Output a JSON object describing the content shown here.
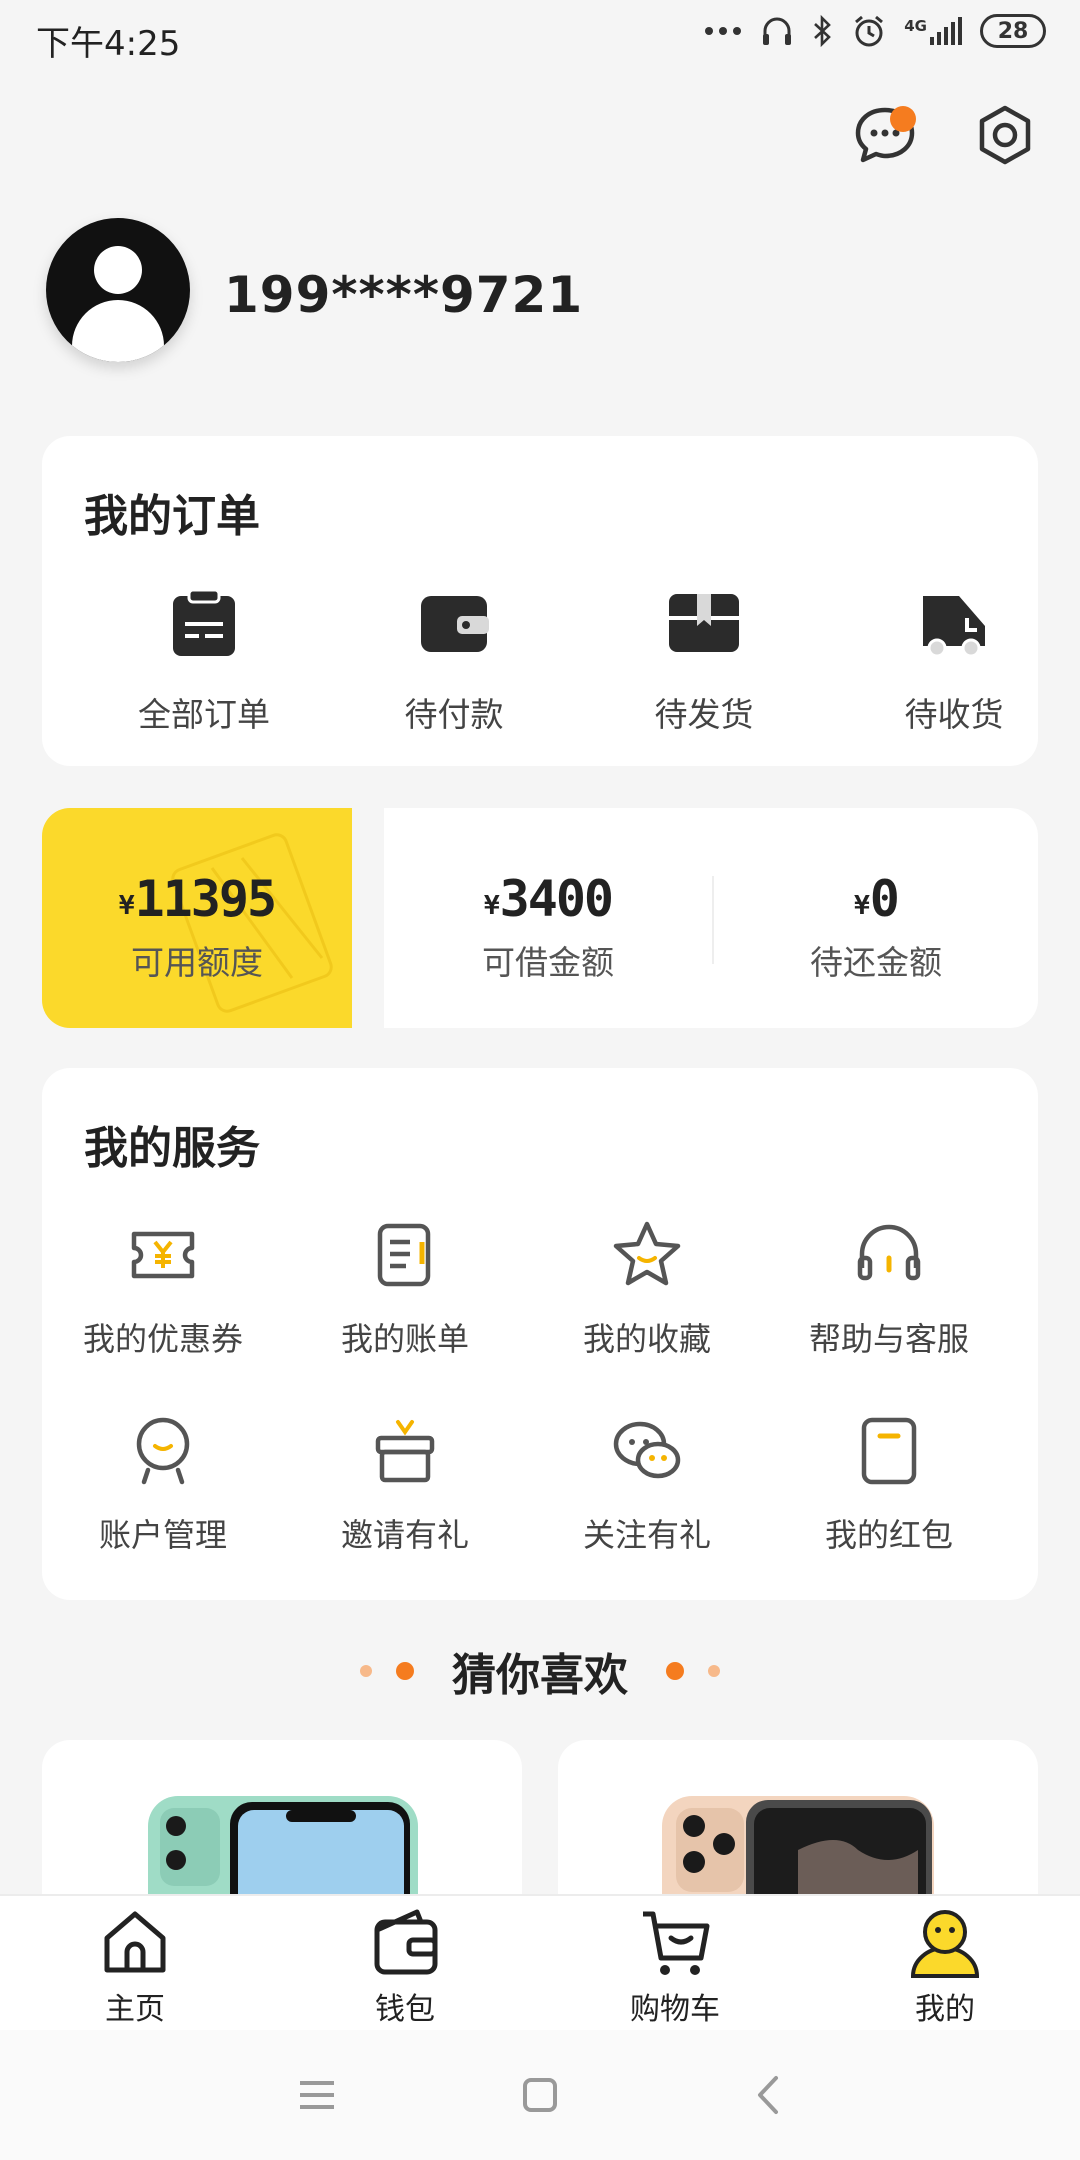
{
  "status_bar": {
    "time": "下午4:25",
    "network": "4G",
    "battery": "28"
  },
  "profile": {
    "phone": "199****9721"
  },
  "orders": {
    "title": "我的订单",
    "items": [
      {
        "label": "全部订单",
        "icon": "clipboard-icon"
      },
      {
        "label": "待付款",
        "icon": "wallet-icon"
      },
      {
        "label": "待发货",
        "icon": "box-icon"
      },
      {
        "label": "待收货",
        "icon": "truck-icon"
      }
    ]
  },
  "credit": {
    "available": {
      "currency": "¥",
      "amount": "11395",
      "label": "可用额度"
    },
    "borrowable": {
      "currency": "¥",
      "amount": "3400",
      "label": "可借金额"
    },
    "pending": {
      "currency": "¥",
      "amount": "0",
      "label": "待还金额"
    }
  },
  "services": {
    "title": "我的服务",
    "items": [
      {
        "label": "我的优惠券",
        "icon": "coupon-icon"
      },
      {
        "label": "我的账单",
        "icon": "bill-icon"
      },
      {
        "label": "我的收藏",
        "icon": "star-icon"
      },
      {
        "label": "帮助与客服",
        "icon": "headset-icon"
      },
      {
        "label": "账户管理",
        "icon": "account-icon"
      },
      {
        "label": "邀请有礼",
        "icon": "gift-icon"
      },
      {
        "label": "关注有礼",
        "icon": "wechat-icon"
      },
      {
        "label": "我的红包",
        "icon": "red-packet-icon"
      }
    ]
  },
  "recommend": {
    "title": "猜你喜欢"
  },
  "bottom_nav": {
    "items": [
      {
        "label": "主页",
        "icon": "home-icon"
      },
      {
        "label": "钱包",
        "icon": "wallet-icon"
      },
      {
        "label": "购物车",
        "icon": "cart-icon"
      },
      {
        "label": "我的",
        "icon": "profile-icon"
      }
    ]
  },
  "colors": {
    "accent": "#f57c1f",
    "yellow": "#fbd92b",
    "dark": "#2b2b2b"
  }
}
